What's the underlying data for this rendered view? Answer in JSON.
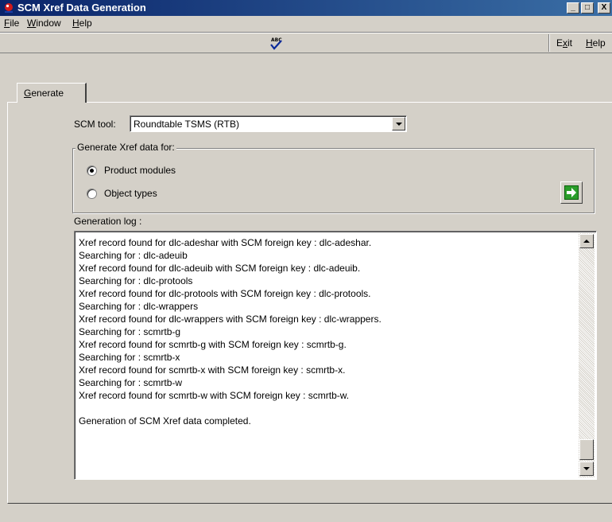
{
  "window": {
    "title": "SCM Xref Data Generation",
    "controls": {
      "minimize": "_",
      "maximize": "□",
      "close": "X"
    }
  },
  "menu": {
    "file_u": "F",
    "file_rest": "ile",
    "window_u": "W",
    "window_rest": "indow",
    "help_u": "H",
    "help_rest": "elp"
  },
  "toolbar": {
    "spellcheck_icon": "spellcheck-icon",
    "spell_abc": "ABC",
    "exit_pre": "E",
    "exit_u": "x",
    "exit_rest": "it",
    "help_u": "H",
    "help_rest": "elp"
  },
  "tab": {
    "generate_u": "G",
    "generate_rest": "enerate"
  },
  "form": {
    "scm_tool_label": "SCM tool:",
    "scm_tool_value": "Roundtable TSMS (RTB)",
    "group_title": "Generate Xref data for:",
    "options": [
      {
        "label": "Product modules",
        "selected": true
      },
      {
        "label": "Object types",
        "selected": false
      }
    ],
    "go_icon": "arrow-right-icon"
  },
  "log": {
    "label": "Generation log :",
    "lines": [
      "Xref record found for dlc-adeshar with SCM foreign key : dlc-adeshar.",
      "Searching for : dlc-adeuib",
      "Xref record found for dlc-adeuib with SCM foreign key : dlc-adeuib.",
      "Searching for : dlc-protools",
      "Xref record found for dlc-protools with SCM foreign key : dlc-protools.",
      "Searching for : dlc-wrappers",
      "Xref record found for dlc-wrappers with SCM foreign key : dlc-wrappers.",
      "Searching for : scmrtb-g",
      "Xref record found for scmrtb-g with SCM foreign key : scmrtb-g.",
      "Searching for : scmrtb-x",
      "Xref record found for scmrtb-x with SCM foreign key : scmrtb-x.",
      "Searching for : scmrtb-w",
      "Xref record found for scmrtb-w with SCM foreign key : scmrtb-w.",
      "",
      "Generation of SCM Xref data completed."
    ]
  },
  "colors": {
    "titlebar_start": "#0a246a",
    "titlebar_end": "#3a6ea5",
    "face": "#d4d0c8",
    "go_green": "#2a9d2a"
  }
}
